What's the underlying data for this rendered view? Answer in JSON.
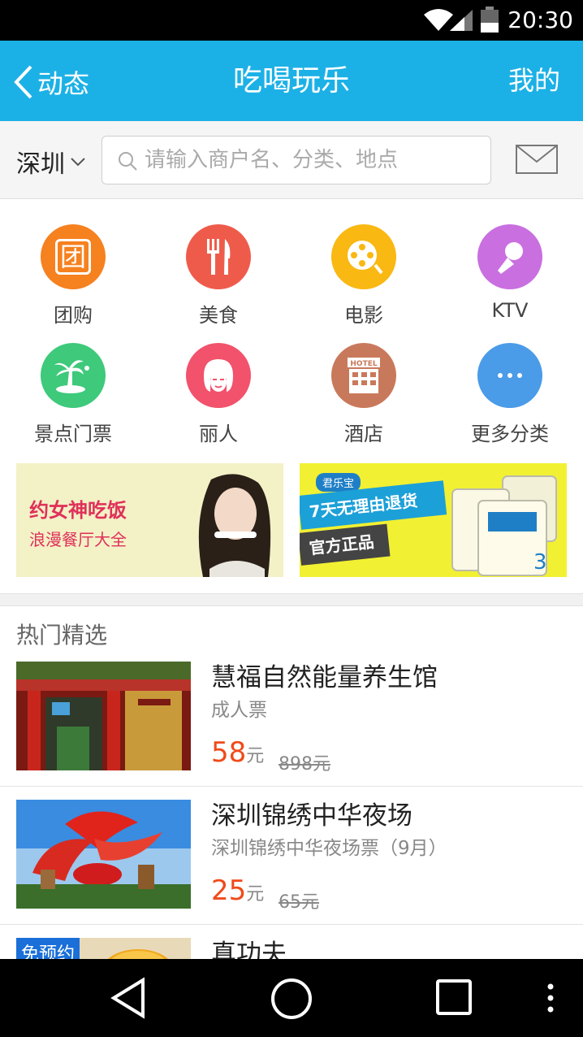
{
  "status_bar": {
    "time": "20:30"
  },
  "nav": {
    "back_label": "动态",
    "title": "吃喝玩乐",
    "right_label": "我的"
  },
  "search": {
    "city": "深圳",
    "placeholder": "请输入商户名、分类、地点"
  },
  "categories": [
    {
      "label": "团购",
      "icon": "group-buy-icon",
      "color": "#f5811f",
      "glyph": "团"
    },
    {
      "label": "美食",
      "icon": "fork-knife-icon",
      "color": "#ef5b4b"
    },
    {
      "label": "电影",
      "icon": "film-reel-icon",
      "color": "#f9b812"
    },
    {
      "label": "KTV",
      "icon": "microphone-icon",
      "color": "#c96fe0"
    },
    {
      "label": "景点门票",
      "icon": "palm-island-icon",
      "color": "#3ec97b"
    },
    {
      "label": "丽人",
      "icon": "beauty-face-icon",
      "color": "#f2526b"
    },
    {
      "label": "酒店",
      "icon": "hotel-icon",
      "color": "#c9795b",
      "glyph": "HOTEL"
    },
    {
      "label": "更多分类",
      "icon": "more-dots-icon",
      "color": "#4a9be8",
      "glyph": "···"
    }
  ],
  "banners": {
    "left": {
      "line1": "约女神吃饭",
      "line2": "浪漫餐厅大全"
    },
    "right": {
      "brand": "君乐宝",
      "line1": "7天无理由退货",
      "line2": "官方正品"
    }
  },
  "section_title": "热门精选",
  "deals": [
    {
      "name": "慧福自然能量养生馆",
      "sub": "成人票",
      "price": "58",
      "unit": "元",
      "orig": "898元"
    },
    {
      "name": "深圳锦绣中华夜场",
      "sub": "深圳锦绣中华夜场票（9月）",
      "price": "25",
      "unit": "元",
      "orig": "65元"
    },
    {
      "name": "真功夫",
      "badge": "免预约"
    }
  ]
}
